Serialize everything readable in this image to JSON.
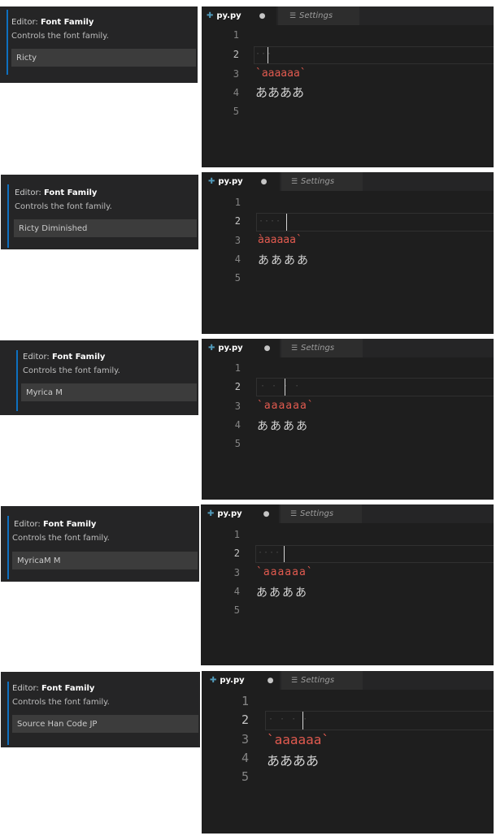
{
  "colors": {
    "string": "#e05a4f",
    "accent": "#0e70c0",
    "python_icon": "#519aba",
    "editor_bg": "#1e1e1e",
    "settings_bg": "#252526"
  },
  "examples": [
    {
      "setting": {
        "prefix": "Editor:",
        "name": "Font Family",
        "description": "Controls the font family.",
        "value": "Ricty"
      },
      "tabs": [
        {
          "label": "py.py",
          "icon": "python-icon",
          "modified_icon": "dot-icon"
        },
        {
          "label": "Settings",
          "icon": "settings-file-icon"
        }
      ],
      "line_numbers": [
        "1",
        "2",
        "3",
        "4",
        "5"
      ],
      "whitespace": "···",
      "code_line3": "`aaaaaa`",
      "code_line4": "ああああ"
    },
    {
      "setting": {
        "prefix": "Editor:",
        "name": "Font Family",
        "description": "Controls the font family.",
        "value": "Ricty Diminished"
      },
      "tabs": [
        {
          "label": "py.py",
          "icon": "python-icon",
          "modified_icon": "dot-icon"
        },
        {
          "label": "Settings",
          "icon": "settings-file-icon"
        }
      ],
      "line_numbers": [
        "1",
        "2",
        "3",
        "4",
        "5"
      ],
      "whitespace": "····",
      "code_line3": "àaaaaa`",
      "code_line4": "ああああ"
    },
    {
      "setting": {
        "prefix": "Editor:",
        "name": "Font Family",
        "description": "Controls the font family.",
        "value": "Myrica M"
      },
      "tabs": [
        {
          "label": "py.py",
          "icon": "python-icon",
          "modified_icon": "dot-icon"
        },
        {
          "label": "Settings",
          "icon": "settings-file-icon"
        }
      ],
      "line_numbers": [
        "1",
        "2",
        "3",
        "4",
        "5"
      ],
      "whitespace": "· · · ·",
      "code_line3": "`aaaaaa`",
      "code_line4": "ああああ"
    },
    {
      "setting": {
        "prefix": "Editor:",
        "name": "Font Family",
        "description": "Controls the font family.",
        "value": "MyricaM M"
      },
      "tabs": [
        {
          "label": "py.py",
          "icon": "python-icon",
          "modified_icon": "dot-icon"
        },
        {
          "label": "Settings",
          "icon": "settings-file-icon"
        }
      ],
      "line_numbers": [
        "1",
        "2",
        "3",
        "4",
        "5"
      ],
      "whitespace": "····",
      "code_line3": "`aaaaaa`",
      "code_line4": "ああああ"
    },
    {
      "setting": {
        "prefix": "Editor:",
        "name": "Font Family",
        "description": "Controls the font family.",
        "value": "Source Han Code JP"
      },
      "tabs": [
        {
          "label": "py.py",
          "icon": "python-icon",
          "modified_icon": "dot-icon"
        },
        {
          "label": "Settings",
          "icon": "settings-file-icon"
        }
      ],
      "line_numbers": [
        "1",
        "2",
        "3",
        "4",
        "5"
      ],
      "whitespace": "· · · ·",
      "code_line3": "`aaaaaa`",
      "code_line4": "ああああ"
    }
  ]
}
